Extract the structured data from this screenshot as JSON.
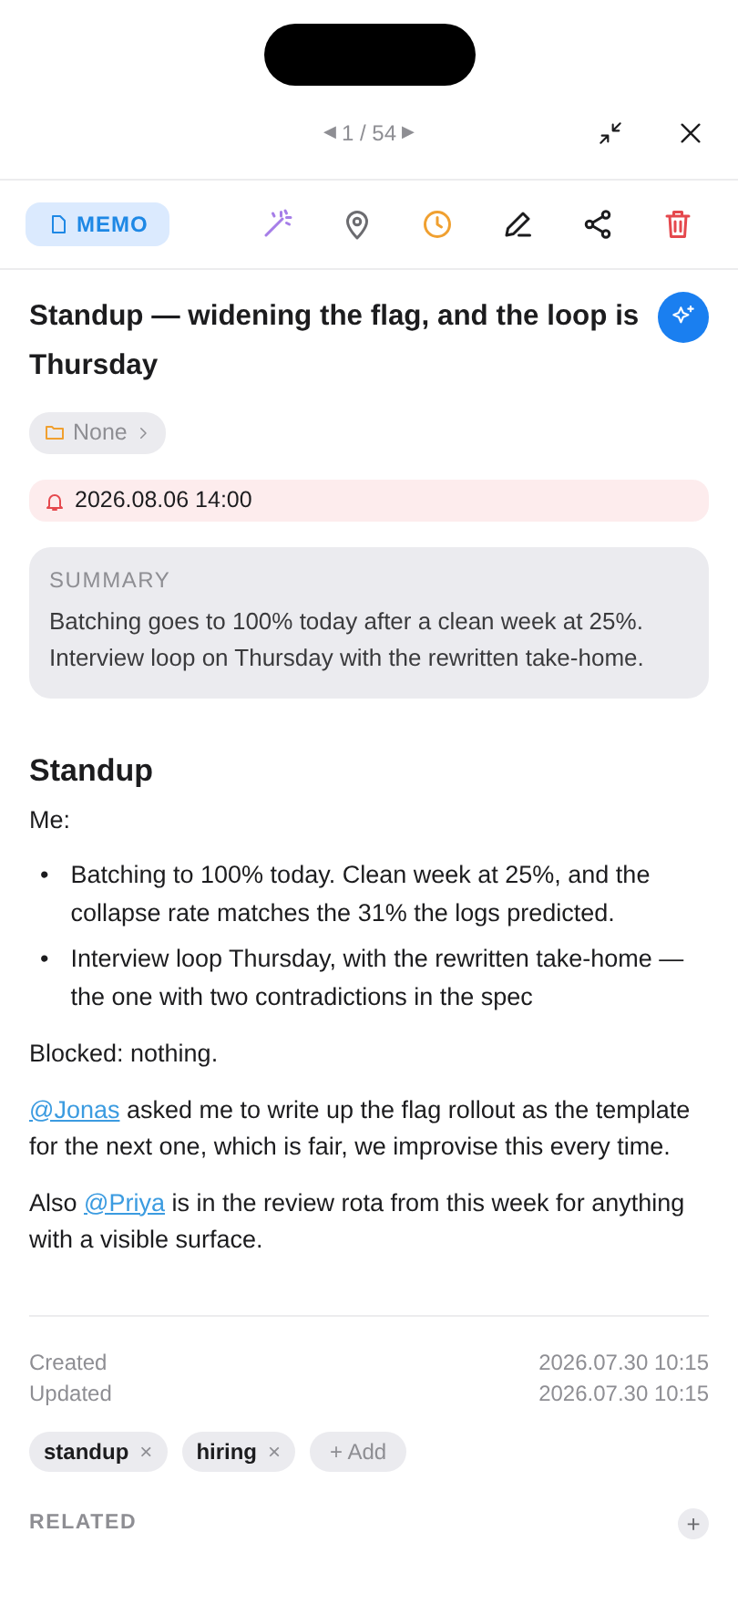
{
  "pager": {
    "prev": "◀",
    "position": "1 / 54",
    "next": "▶"
  },
  "type_badge": "MEMO",
  "title": "Standup — widening the flag, and the loop is Thursday",
  "folder": "None",
  "reminder": "2026.08.06 14:00",
  "summary": {
    "label": "SUMMARY",
    "text": "Batching goes to 100% today after a clean week at 25%. Interview loop on Thursday with the rewritten take-home."
  },
  "body": [
    {
      "kind": "heading",
      "text": "Standup"
    },
    {
      "kind": "paragraph",
      "parts": [
        {
          "text": "Me:"
        }
      ]
    },
    {
      "kind": "bullets",
      "marker": "•",
      "items": [
        "Batching to 100% today. Clean week at 25%, and the collapse rate matches the 31% the logs predicted.",
        "Interview loop Thursday, with the rewritten take-home — the one with two contradictions in the spec"
      ]
    },
    {
      "kind": "paragraph",
      "parts": [
        {
          "text": "Blocked: nothing."
        }
      ]
    },
    {
      "kind": "paragraph",
      "parts": [
        {
          "text": "@Jonas",
          "mention": true
        },
        {
          "text": " asked me to write up the flag rollout as the template for the next one, which is fair, we improvise this every time."
        }
      ]
    },
    {
      "kind": "paragraph",
      "parts": [
        {
          "text": "Also "
        },
        {
          "text": "@Priya",
          "mention": true
        },
        {
          "text": " is in the review rota from this week for anything with a visible surface."
        }
      ]
    }
  ],
  "meta": [
    {
      "label": "Created",
      "value": "2026.07.30 10:15"
    },
    {
      "label": "Updated",
      "value": "2026.07.30 10:15"
    }
  ],
  "tags": [
    {
      "label": "standup",
      "remove": "×"
    },
    {
      "label": "hiring",
      "remove": "×"
    }
  ],
  "add_tag": "+ Add",
  "related": {
    "label": "RELATED",
    "add": "+"
  }
}
